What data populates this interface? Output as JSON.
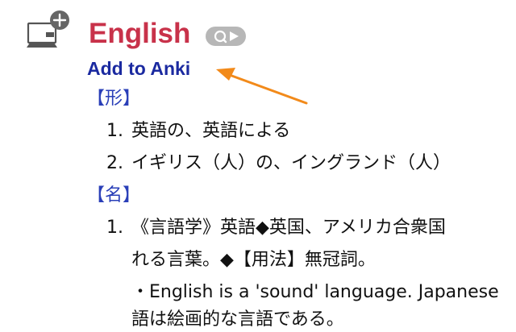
{
  "entry": {
    "headword": "English",
    "add_to_anki": "Add to Anki",
    "sections": [
      {
        "pos": "【形】",
        "definitions": [
          {
            "num": "1.",
            "text": "英語の、英語による"
          },
          {
            "num": "2.",
            "text": "イギリス（人）の、イングランド（人）"
          }
        ]
      },
      {
        "pos": "【名】",
        "definitions": [
          {
            "num": "1.",
            "lines": [
              "《言語学》英語◆英国、アメリカ合衆国",
              "れる言葉。◆【用法】無冠詞。",
              "・English is a 'sound' language. Japanese",
              "語は絵画的な言語である。"
            ]
          }
        ]
      }
    ]
  },
  "icons": {
    "dictionary": "tv-plus-icon",
    "audio": "search-play-icon",
    "annotation": "orange-arrow-icon"
  },
  "colors": {
    "headword": "#c8324a",
    "anki_link": "#1b2aa0",
    "part_of_speech": "#2a3fb8",
    "arrow": "#f28a1a",
    "icon_gray": "#b7b7b7"
  }
}
